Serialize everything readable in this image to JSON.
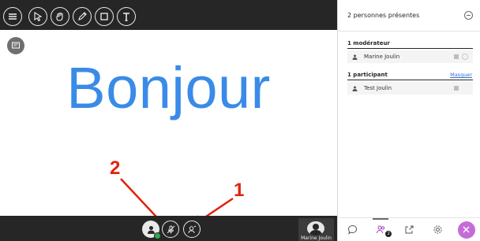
{
  "board": {
    "text": "Bonjour",
    "text_color": "#3a8be8"
  },
  "annotations": {
    "label_1": "1",
    "label_2": "2",
    "color": "#e0230e"
  },
  "toolbar": {
    "icons": [
      "menu-icon",
      "select-arrow-icon",
      "pan-hand-icon",
      "pencil-icon",
      "rectangle-icon",
      "text-icon"
    ]
  },
  "bottom_controls": {
    "icons": [
      "avatar-icon",
      "microphone-muted-icon",
      "camera-off-icon"
    ],
    "status_color": "#2fa84f"
  },
  "presenter_tile": {
    "name": "Marine Joulin"
  },
  "panel": {
    "title": "2 personnes présentes",
    "moderators": {
      "heading": "1 modérateur",
      "people": [
        {
          "name": "Marine Joulin"
        }
      ]
    },
    "participants": {
      "heading": "1 participant",
      "hide_label": "Masquer",
      "people": [
        {
          "name": "Test Joulin"
        }
      ]
    },
    "tabs": [
      {
        "icon": "chat-icon"
      },
      {
        "icon": "participants-icon",
        "badge": "2",
        "active": true
      },
      {
        "icon": "share-icon"
      },
      {
        "icon": "settings-icon"
      },
      {
        "icon": "close-icon",
        "color": "#c56bd9"
      }
    ]
  }
}
